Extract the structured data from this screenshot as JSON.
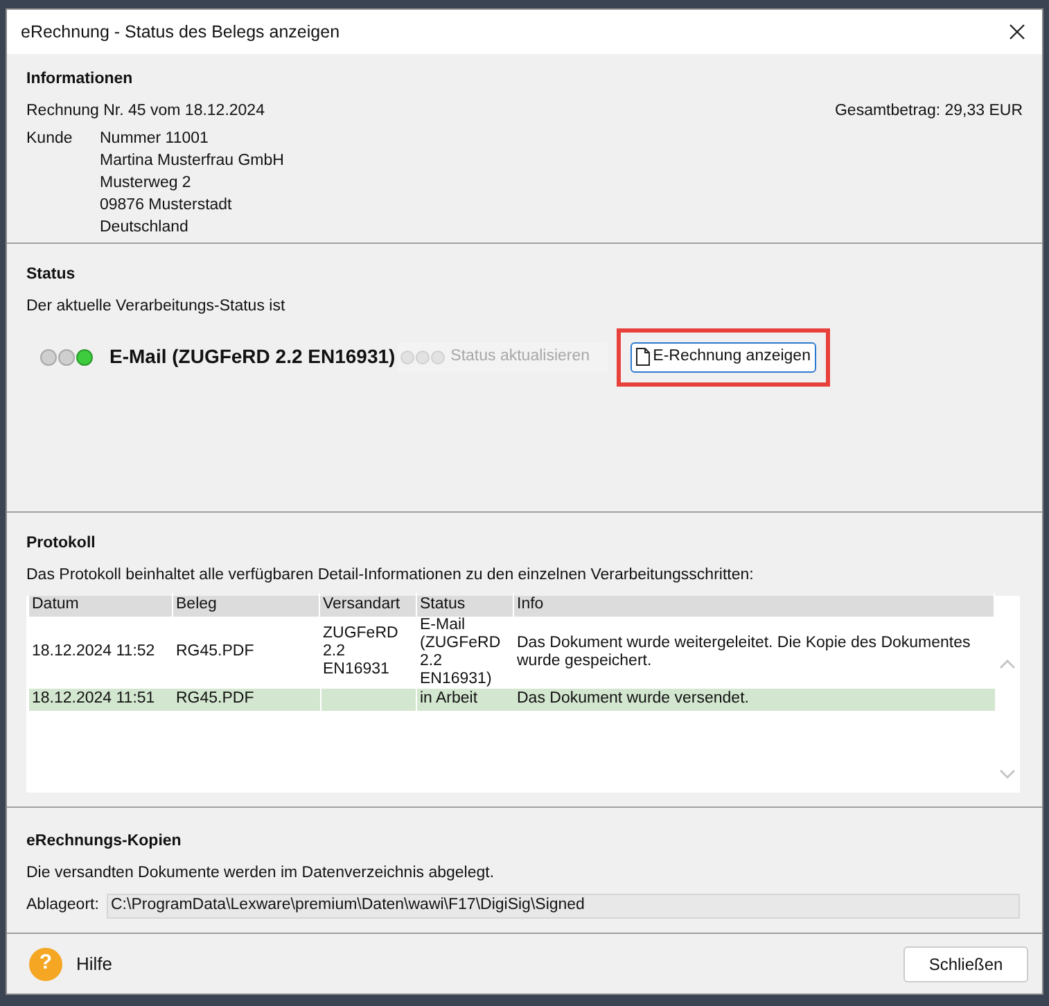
{
  "window": {
    "title": "eRechnung - Status des Belegs anzeigen"
  },
  "info": {
    "heading": "Informationen",
    "invoice": "Rechnung Nr. 45 vom 18.12.2024",
    "total": "Gesamtbetrag: 29,33 EUR",
    "customer_label": "Kunde",
    "customer_lines": [
      "Nummer  11001",
      "Martina Musterfrau GmbH",
      "Musterweg 2",
      "09876 Musterstadt",
      "Deutschland"
    ]
  },
  "status": {
    "heading": "Status",
    "intro": "Der aktuelle Verarbeitungs-Status ist",
    "lights": [
      {
        "on": false
      },
      {
        "on": false
      },
      {
        "on": true
      }
    ],
    "value": "E-Mail (ZUGFeRD 2.2 EN16931)",
    "refresh": {
      "label": "Status aktualisieren",
      "disabled": true,
      "lights": [
        {
          "on": false
        },
        {
          "on": false
        },
        {
          "on": false
        }
      ]
    },
    "show_button": {
      "label": "E-Rechnung anzeigen",
      "highlighted": true
    }
  },
  "protocol": {
    "heading": "Protokoll",
    "intro": "Das Protokoll beinhaltet alle verfügbaren Detail-Informationen zu den einzelnen Verarbeitungsschritten:",
    "columns": [
      "Datum",
      "Beleg",
      "Versandart",
      "Status",
      "Info"
    ],
    "rows": [
      {
        "selected": false,
        "cells": [
          "18.12.2024 11:52",
          "RG45.PDF",
          "ZUGFeRD 2.2 EN16931",
          "E-Mail (ZUGFeRD 2.2 EN16931)",
          "Das Dokument wurde weitergeleitet. Die Kopie des Dokumentes wurde gespeichert."
        ]
      },
      {
        "selected": true,
        "cells": [
          "18.12.2024 11:51",
          "RG45.PDF",
          "",
          "in Arbeit",
          "Das Dokument wurde versendet."
        ]
      }
    ]
  },
  "copies": {
    "heading": "eRechnungs-Kopien",
    "intro": "Die versandten Dokumente werden im Datenverzeichnis abgelegt.",
    "location_label": "Ablageort:",
    "location": "C:\\ProgramData\\Lexware\\premium\\Daten\\wawi\\F17\\DigiSig\\Signed"
  },
  "footer": {
    "help": "Hilfe",
    "help_icon": "?",
    "close": "Schließen"
  }
}
